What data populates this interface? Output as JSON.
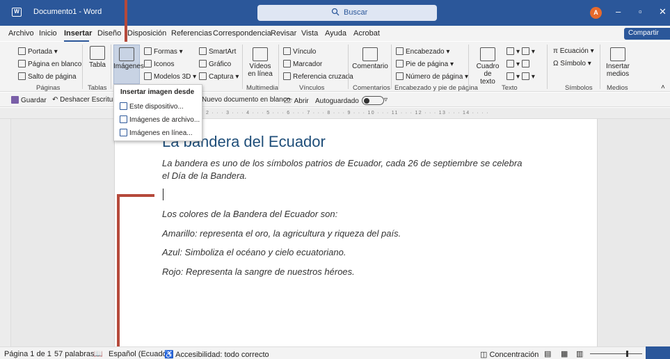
{
  "window": {
    "title": "Documento1 - Word",
    "search_placeholder": "Buscar",
    "avatar_initial": "A",
    "controls": {
      "minimize": "–",
      "restore": "▫",
      "close": "✕"
    }
  },
  "tabs": [
    "Archivo",
    "Inicio",
    "Insertar",
    "Diseño",
    "Disposición",
    "Referencias",
    "Correspondencia",
    "Revisar",
    "Vista",
    "Ayuda",
    "Acrobat"
  ],
  "active_tab": "Insertar",
  "share_label": "Compartir",
  "ribbon": {
    "paginas": {
      "portada": "Portada",
      "pagina_blanco": "Página en blanco",
      "salto": "Salto de página",
      "group": "Páginas"
    },
    "tablas": {
      "tabla": "Tabla",
      "group": "Tablas"
    },
    "ilustraciones": {
      "imagenes": "Imágenes",
      "formas": "Formas",
      "iconos": "Iconos",
      "modelos3d": "Modelos 3D",
      "smartart": "SmartArt",
      "grafico": "Gráfico",
      "captura": "Captura"
    },
    "multimedia": {
      "videos": "Vídeos",
      "en_linea": "en línea",
      "group": "Multimedia"
    },
    "vinculos": {
      "vinculo": "Vínculo",
      "marcador": "Marcador",
      "referencia": "Referencia cruzada",
      "group": "Vínculos"
    },
    "comentarios": {
      "comentario": "Comentario",
      "group": "Comentarios"
    },
    "encabezado": {
      "encabezado": "Encabezado",
      "pie": "Pie de página",
      "numero": "Número de página",
      "group": "Encabezado y pie de página"
    },
    "texto": {
      "cuadro": "Cuadro de",
      "texto": "texto",
      "group": "Texto"
    },
    "simbolos": {
      "ecuacion": "Ecuación",
      "simbolo": "Símbolo",
      "group": "Símbolos"
    },
    "medios": {
      "insertar": "Insertar",
      "medios": "medios",
      "group": "Medios"
    }
  },
  "qat": {
    "guardar": "Guardar",
    "deshacer": "Deshacer Escritura",
    "nuevo": "Nuevo documento en blanco",
    "abrir": "Abrir",
    "autoguardado": "Autoguardado"
  },
  "ruler_text": "2 · · · 3 · · · 4 · · · 5 · · · 6 · · · 7 · · · 8 · · · 9 · · · 10 · · · 11 · · · 12 · · · 13 · · · 14 · · · ·",
  "dropdown": {
    "header": "Insertar imagen desde",
    "items": [
      "Este dispositivo...",
      "Imágenes de archivo...",
      "Imágenes en línea..."
    ]
  },
  "document": {
    "title": "La bandera del Ecuador",
    "para1_line1": "La bandera es uno de los símbolos patrios de Ecuador,  cada 26 de septiembre se celebra",
    "para1_line2": "el Día de la Bandera.",
    "colors_intro": "Los colores de la Bandera del Ecuador son:",
    "amarillo": "Amarillo: representa el oro, la agricultura y riqueza del país.",
    "azul": "Azul: Simboliza el océano y cielo ecuatoriano.",
    "rojo": "Rojo: Representa la sangre de nuestros héroes."
  },
  "status": {
    "page": "Página 1 de 1",
    "words": "57 palabras",
    "language": "Español (Ecuador)",
    "accessibility": "Accesibilidad: todo correcto",
    "focus": "Concentración"
  },
  "colors": {
    "brand": "#2b579a",
    "annotation": "#b5493b"
  }
}
